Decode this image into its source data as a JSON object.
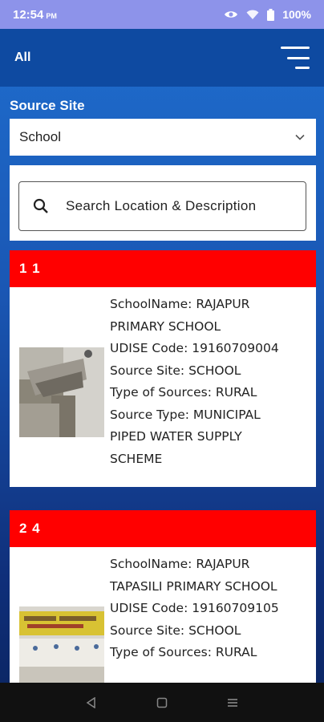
{
  "status_bar": {
    "time": "12:54",
    "meridiem": "PM",
    "battery": "100%"
  },
  "app_bar": {
    "title": "All",
    "menu_icon": "filter-menu-icon"
  },
  "filter": {
    "label": "Source Site",
    "selected": "School"
  },
  "search": {
    "placeholder": "Search Location & Description"
  },
  "cards": [
    {
      "header": "1 1",
      "lines": [
        "SchoolName: RAJAPUR",
        "PRIMARY SCHOOL",
        "UDISE Code: 19160709004",
        "Source Site: SCHOOL",
        "Type of Sources: RURAL",
        "Source Type: MUNICIPAL",
        "PIPED WATER SUPPLY",
        "SCHEME"
      ]
    },
    {
      "header": "2 4",
      "lines": [
        "SchoolName: RAJAPUR",
        "TAPASILI PRIMARY SCHOOL",
        "UDISE Code: 19160709105",
        "Source Site: SCHOOL",
        "Type of Sources: RURAL"
      ]
    }
  ],
  "colors": {
    "header_red": "#ff0000",
    "app_bar_blue": "#0e4aa1",
    "status_bar": "#8d93ea"
  }
}
